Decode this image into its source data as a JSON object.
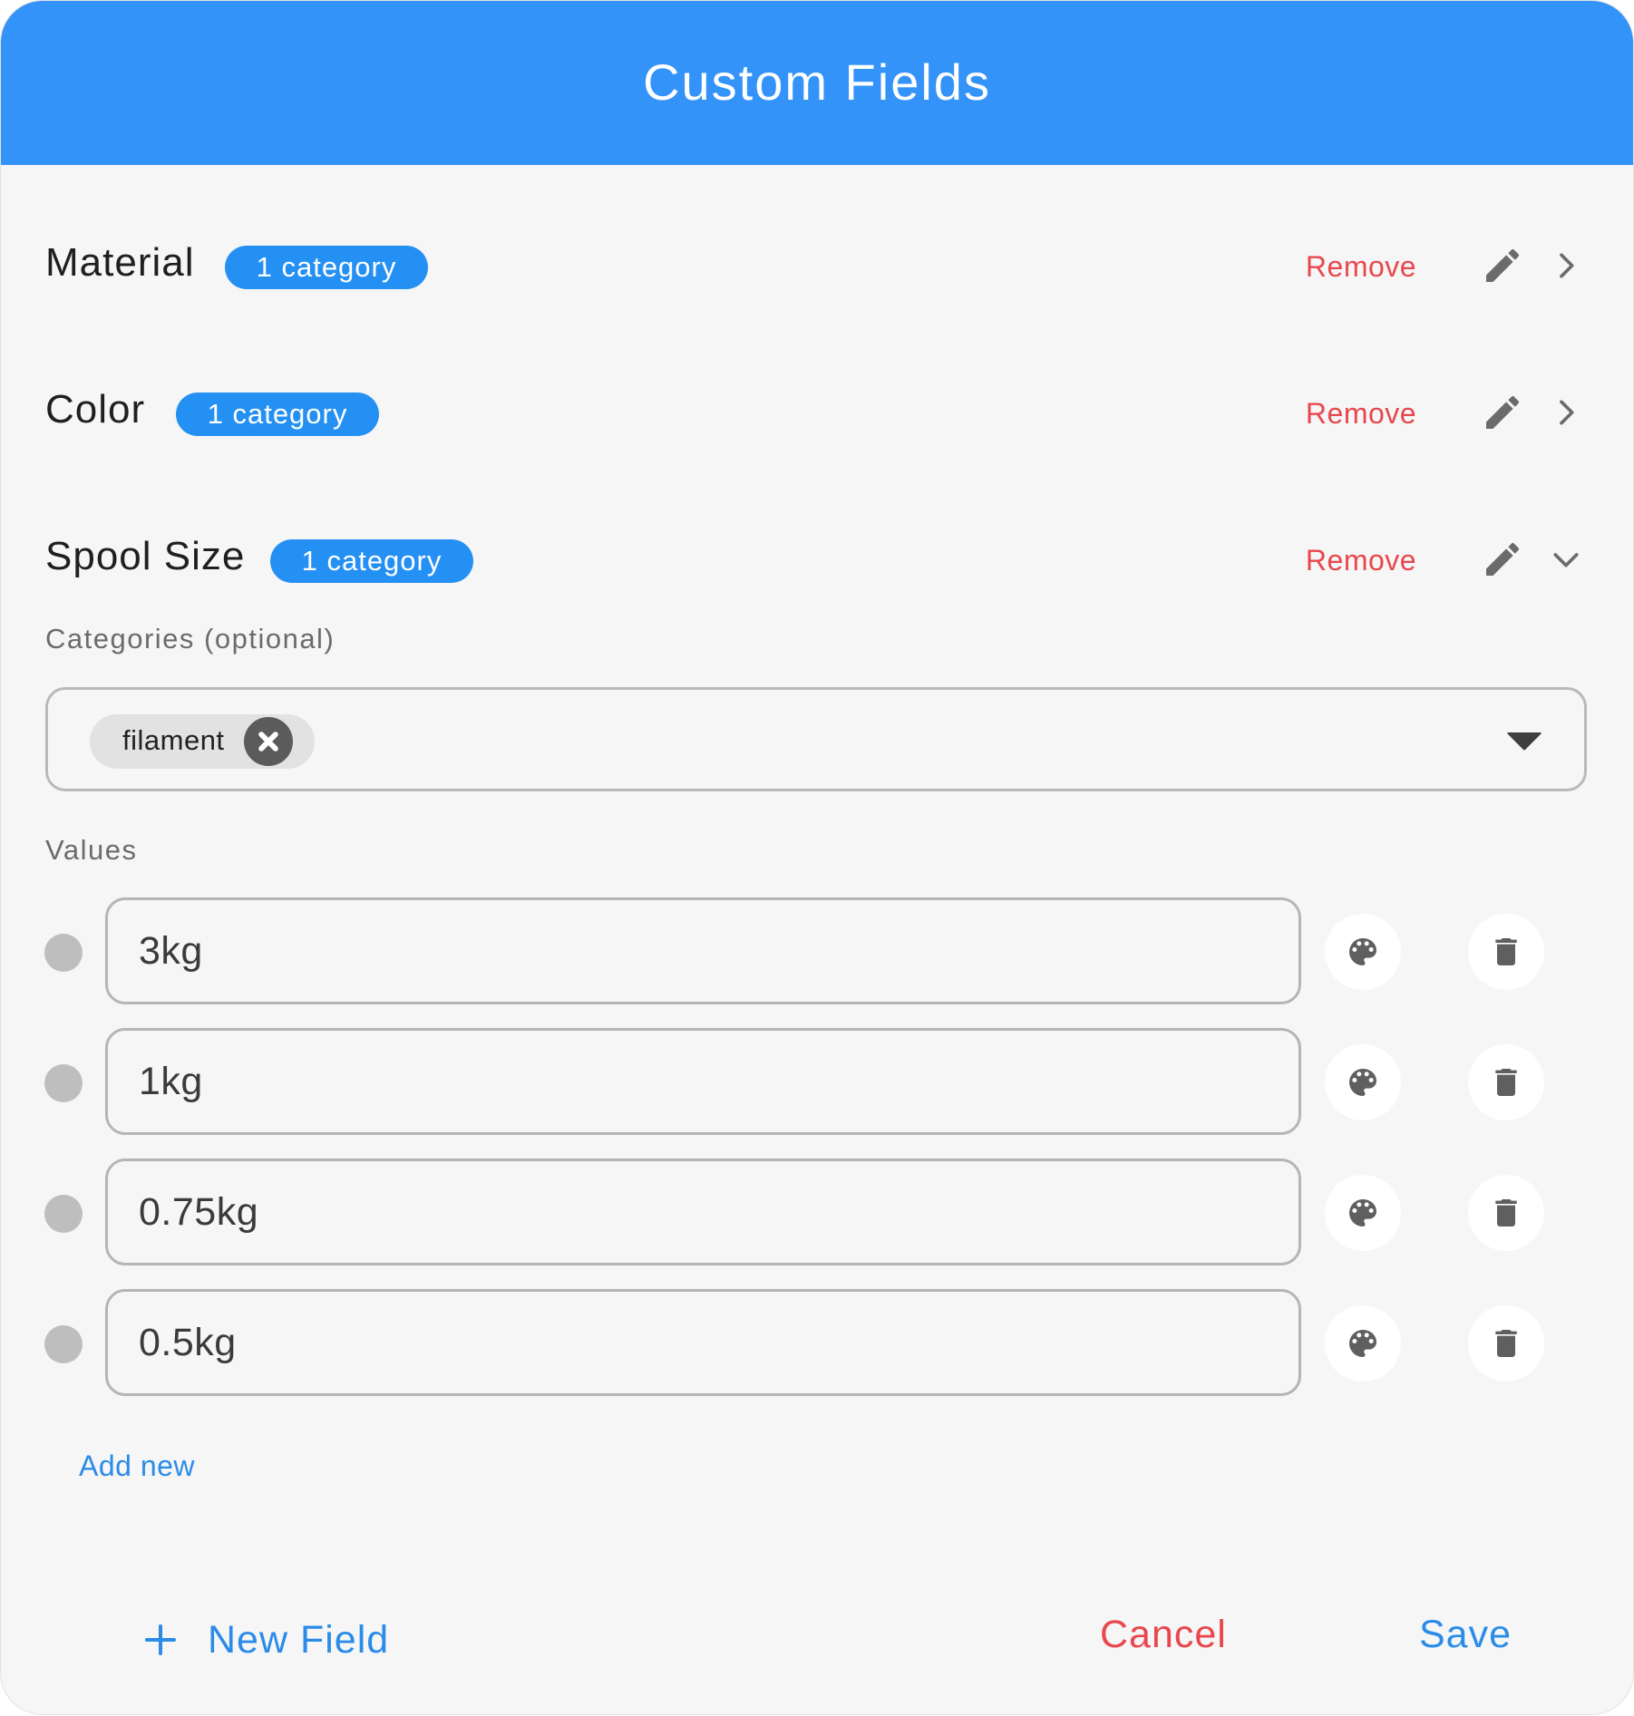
{
  "dialog": {
    "title": "Custom Fields"
  },
  "fields": [
    {
      "name": "Material",
      "badge": "1 category",
      "remove_label": "Remove",
      "expanded": false
    },
    {
      "name": "Color",
      "badge": "1 category",
      "remove_label": "Remove",
      "expanded": false
    },
    {
      "name": "Spool Size",
      "badge": "1 category",
      "remove_label": "Remove",
      "expanded": true
    }
  ],
  "expanded_field": {
    "categories_label": "Categories (optional)",
    "selected_categories": [
      "filament"
    ],
    "values_label": "Values",
    "values": [
      "3kg",
      "1kg",
      "0.75kg",
      "0.5kg"
    ],
    "add_new_label": "Add new"
  },
  "footer": {
    "new_field_label": "New Field",
    "cancel_label": "Cancel",
    "save_label": "Save"
  },
  "icons": {
    "edit": "pencil-icon",
    "collapsed": "chevron-right-icon",
    "expanded": "chevron-down-icon",
    "dropdown": "caret-down-icon",
    "chip_remove": "close-circle-icon",
    "color": "palette-icon",
    "delete": "trash-icon",
    "add": "plus-icon"
  },
  "colors": {
    "header": "#3393f8",
    "badge": "#2590f3",
    "remove": "#e8484d",
    "link": "#2a8ce8",
    "background": "#f6f6f6"
  }
}
